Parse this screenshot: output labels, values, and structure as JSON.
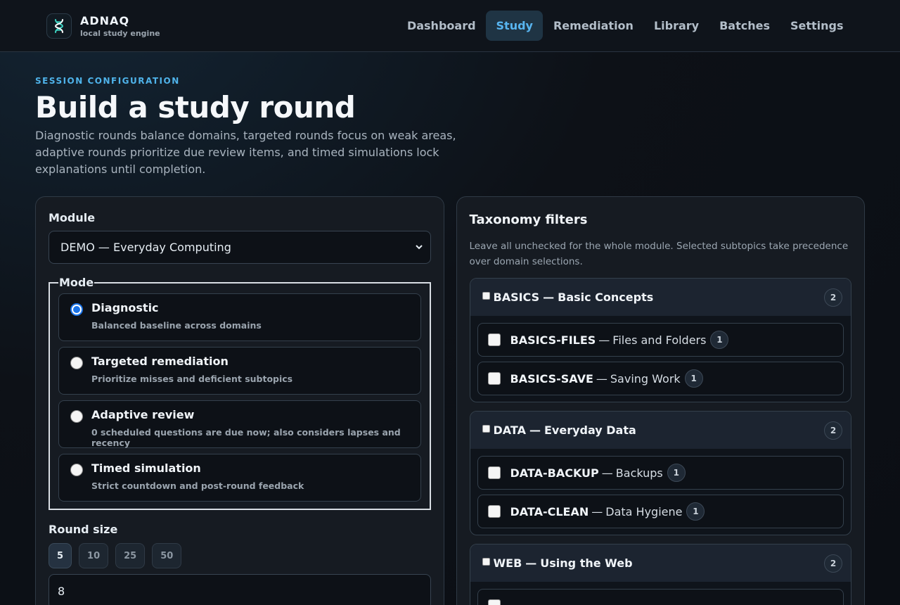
{
  "brand": {
    "name": "ADNAQ",
    "subtitle": "local study engine"
  },
  "nav": [
    {
      "label": "Dashboard",
      "active": false
    },
    {
      "label": "Study",
      "active": true
    },
    {
      "label": "Remediation",
      "active": false
    },
    {
      "label": "Library",
      "active": false
    },
    {
      "label": "Batches",
      "active": false
    },
    {
      "label": "Settings",
      "active": false
    }
  ],
  "hero": {
    "eyebrow": "SESSION CONFIGURATION",
    "title": "Build a study round",
    "description": "Diagnostic rounds balance domains, targeted rounds focus on weak areas, adaptive rounds prioritize due review items, and timed simulations lock explanations until completion."
  },
  "config": {
    "module_label": "Module",
    "module_value": "DEMO — Everyday Computing",
    "mode_label": "Mode",
    "modes": [
      {
        "title": "Diagnostic",
        "subtitle": "Balanced baseline across domains",
        "checked": true
      },
      {
        "title": "Targeted remediation",
        "subtitle": "Prioritize misses and deficient subtopics",
        "checked": false
      },
      {
        "title": "Adaptive review",
        "subtitle": "0 scheduled questions are due now; also considers lapses and recency",
        "checked": false
      },
      {
        "title": "Timed simulation",
        "subtitle": "Strict countdown and post-round feedback",
        "checked": false
      }
    ],
    "round_size_label": "Round size",
    "round_sizes": [
      "5",
      "10",
      "25",
      "50"
    ],
    "round_size_active": "5",
    "round_size_value": "8"
  },
  "taxonomy": {
    "title": "Taxonomy filters",
    "description": "Leave all unchecked for the whole module. Selected subtopics take precedence over domain selections.",
    "domains": [
      {
        "code": "BASICS",
        "name": "Basic Concepts",
        "count": "2",
        "subtopics": [
          {
            "code": "BASICS-FILES",
            "name": "Files and Folders",
            "count": "1"
          },
          {
            "code": "BASICS-SAVE",
            "name": "Saving Work",
            "count": "1"
          }
        ]
      },
      {
        "code": "DATA",
        "name": "Everyday Data",
        "count": "2",
        "subtopics": [
          {
            "code": "DATA-BACKUP",
            "name": "Backups",
            "count": "1"
          },
          {
            "code": "DATA-CLEAN",
            "name": "Data Hygiene",
            "count": "1"
          }
        ]
      },
      {
        "code": "WEB",
        "name": "Using the Web",
        "count": "2",
        "subtopics": []
      }
    ]
  },
  "colors": {
    "accent": "#4fb3ea",
    "nav_active_bg": "#1f3444",
    "radio_checked": "#1a73e8"
  },
  "icons": {
    "logo": "dna-icon",
    "select": "chevron-down-icon"
  }
}
